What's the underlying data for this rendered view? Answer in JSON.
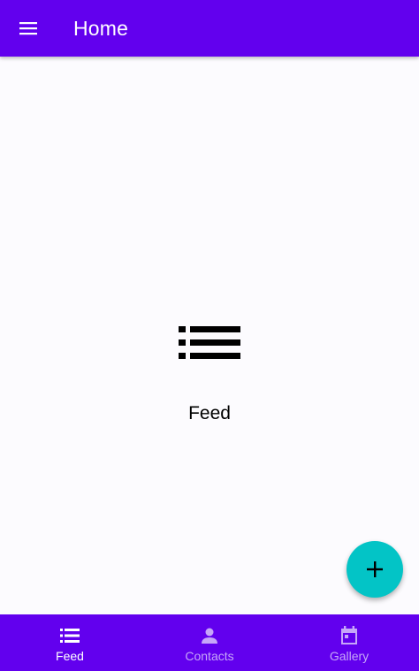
{
  "app_bar": {
    "title": "Home",
    "menu_icon": "menu-icon",
    "background": "#6200ee"
  },
  "content": {
    "icon": "list-icon",
    "label": "Feed"
  },
  "fab": {
    "icon": "add-icon",
    "color": "#03c4c6"
  },
  "bottom_nav": {
    "background": "#6200ee",
    "items": [
      {
        "label": "Feed",
        "icon": "list-icon",
        "active": true
      },
      {
        "label": "Contacts",
        "icon": "person-icon",
        "active": false
      },
      {
        "label": "Gallery",
        "icon": "calendar-icon",
        "active": false
      }
    ]
  }
}
